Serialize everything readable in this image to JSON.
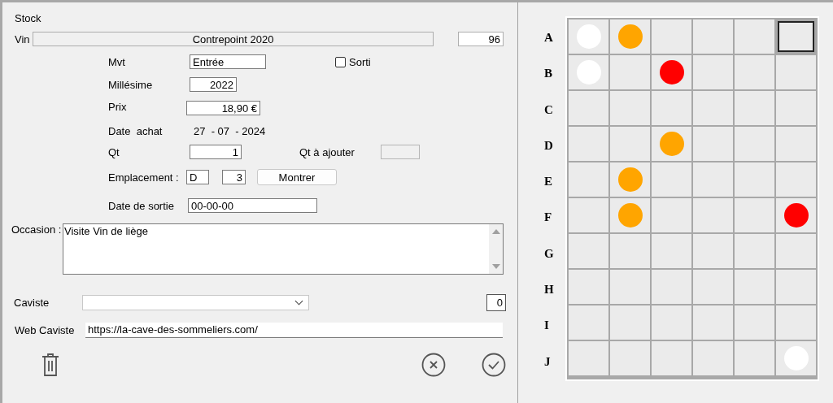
{
  "title": "Stock",
  "wine": {
    "label": "Vin",
    "value": "Contrepoint 2020",
    "number": "96"
  },
  "movement": {
    "label": "Mvt",
    "value": "Entrée"
  },
  "sorti": {
    "label": "Sorti",
    "checked": false
  },
  "vintage": {
    "label": "Millésime",
    "value": "2022"
  },
  "price": {
    "label": "Prix",
    "value": "18,90 €"
  },
  "purchase_date": {
    "label": "Date  achat",
    "value": "27  - 07  - 2024"
  },
  "quantity": {
    "label": "Qt",
    "value": "1"
  },
  "qty_to_add": {
    "label": "Qt à ajouter",
    "disabled": true
  },
  "location": {
    "label": "Emplacement :",
    "row": "D",
    "column": "3",
    "button": "Montrer"
  },
  "exit_date": {
    "label": "Date de sortie",
    "value": "00-00-00"
  },
  "occasion": {
    "label": "Occasion :",
    "value": "Visite Vin de liège"
  },
  "caviste": {
    "label": "Caviste",
    "count": "0"
  },
  "web": {
    "label": "Web Caviste",
    "value": "https://la-cave-des-sommeliers.com/"
  },
  "rack": [
    {
      "label": "A",
      "cells": [
        {
          "color": "#ffffff",
          "selected": false
        },
        {
          "color": "#ffa500",
          "selected": false
        },
        {
          "selected": false
        },
        {
          "selected": false
        },
        {
          "selected": false
        },
        {
          "selected": true
        }
      ]
    },
    {
      "label": "B",
      "cells": [
        {
          "color": "#ffffff",
          "selected": false
        },
        {
          "selected": false
        },
        {
          "color": "#ff0000",
          "selected": false
        },
        {
          "selected": false
        },
        {
          "selected": false
        },
        {
          "selected": false
        }
      ]
    },
    {
      "label": "C",
      "cells": [
        {
          "selected": false
        },
        {
          "selected": false
        },
        {
          "selected": false
        },
        {
          "selected": false
        },
        {
          "selected": false
        },
        {
          "selected": false
        }
      ]
    },
    {
      "label": "D",
      "cells": [
        {
          "selected": false
        },
        {
          "selected": false
        },
        {
          "color": "#ffa500",
          "selected": false
        },
        {
          "selected": false
        },
        {
          "selected": false
        },
        {
          "selected": false
        }
      ]
    },
    {
      "label": "E",
      "cells": [
        {
          "selected": false
        },
        {
          "color": "#ffa500",
          "selected": false
        },
        {
          "selected": false
        },
        {
          "selected": false
        },
        {
          "selected": false
        },
        {
          "selected": false
        }
      ]
    },
    {
      "label": "F",
      "cells": [
        {
          "selected": false
        },
        {
          "color": "#ffa500",
          "selected": false
        },
        {
          "selected": false
        },
        {
          "selected": false
        },
        {
          "selected": false
        },
        {
          "color": "#ff0000",
          "selected": false
        }
      ]
    },
    {
      "label": "G",
      "cells": [
        {
          "selected": false
        },
        {
          "selected": false
        },
        {
          "selected": false
        },
        {
          "selected": false
        },
        {
          "selected": false
        },
        {
          "selected": false
        }
      ]
    },
    {
      "label": "H",
      "cells": [
        {
          "selected": false
        },
        {
          "selected": false
        },
        {
          "selected": false
        },
        {
          "selected": false
        },
        {
          "selected": false
        },
        {
          "selected": false
        }
      ]
    },
    {
      "label": "I",
      "cells": [
        {
          "selected": false
        },
        {
          "selected": false
        },
        {
          "selected": false
        },
        {
          "selected": false
        },
        {
          "selected": false
        },
        {
          "selected": false
        }
      ]
    },
    {
      "label": "J",
      "cells": [
        {
          "selected": false
        },
        {
          "selected": false
        },
        {
          "selected": false
        },
        {
          "selected": false
        },
        {
          "selected": false
        },
        {
          "color": "#ffffff",
          "selected": false
        }
      ]
    }
  ]
}
